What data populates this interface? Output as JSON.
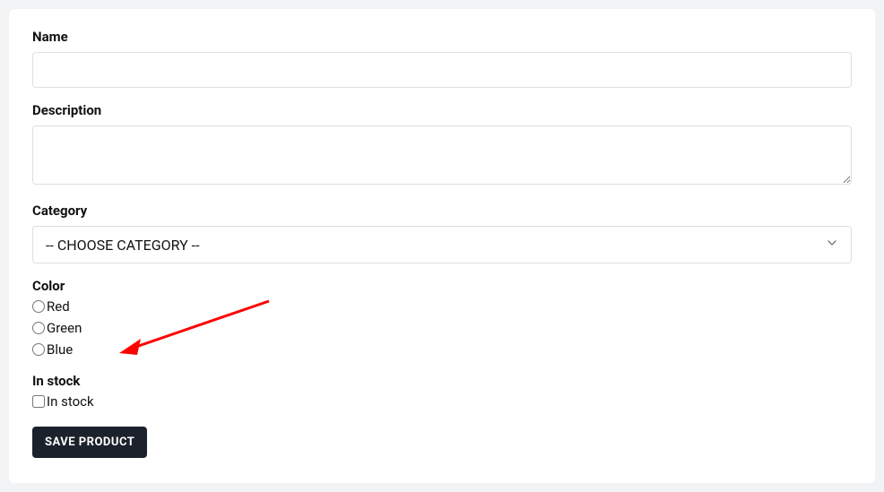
{
  "form": {
    "name": {
      "label": "Name",
      "value": ""
    },
    "description": {
      "label": "Description",
      "value": ""
    },
    "category": {
      "label": "Category",
      "selected": "-- CHOOSE CATEGORY --"
    },
    "color": {
      "label": "Color",
      "options": [
        {
          "label": "Red"
        },
        {
          "label": "Green"
        },
        {
          "label": "Blue"
        }
      ]
    },
    "stock": {
      "label": "In stock",
      "checkbox_label": "In stock"
    },
    "submit": {
      "label": "SAVE PRODUCT"
    }
  }
}
